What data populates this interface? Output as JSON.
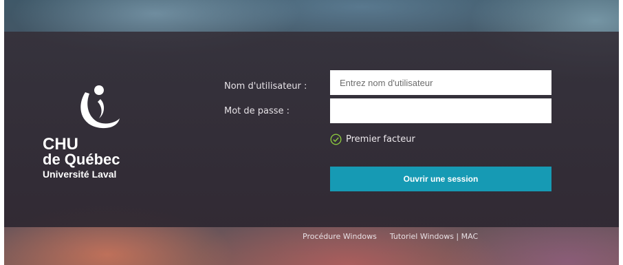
{
  "logo": {
    "line1": "CHU",
    "line2": "de Québec",
    "line3": "Université Laval"
  },
  "form": {
    "username_label": "Nom d'utilisateur :",
    "username_placeholder": "Entrez nom d'utilisateur",
    "username_value": "",
    "password_label": "Mot de passe :",
    "password_value": "",
    "factor_text": "Premier facteur",
    "factor_icon": "check-circle-icon",
    "submit_label": "Ouvrir une session"
  },
  "footer": {
    "link1": "Procédure Windows",
    "link2": "Tutoriel Windows | MAC"
  },
  "colors": {
    "button": "#169ab4",
    "check": "#8ac63f"
  }
}
